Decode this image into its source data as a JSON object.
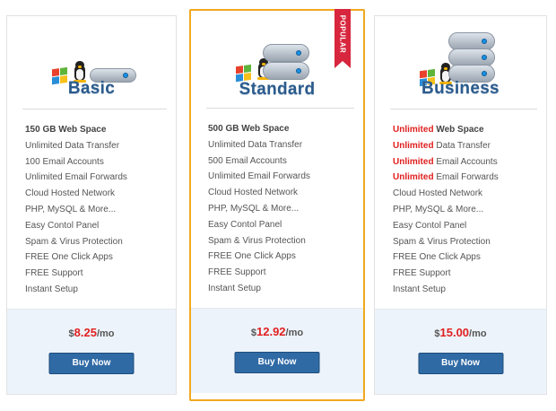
{
  "plans": [
    {
      "title": "Basic",
      "features": [
        {
          "hl": "",
          "text": "150 GB Web Space"
        },
        {
          "hl": "",
          "text": "Unlimited Data Transfer"
        },
        {
          "hl": "",
          "text": "100 Email Accounts"
        },
        {
          "hl": "",
          "text": "Unlimited Email Forwards"
        },
        {
          "hl": "",
          "text": "Cloud Hosted Network"
        },
        {
          "hl": "",
          "text": "PHP, MySQL & More..."
        },
        {
          "hl": "",
          "text": "Easy Contol Panel"
        },
        {
          "hl": "",
          "text": "Spam & Virus Protection"
        },
        {
          "hl": "",
          "text": "FREE One Click Apps"
        },
        {
          "hl": "",
          "text": "FREE Support"
        },
        {
          "hl": "",
          "text": "Instant Setup"
        }
      ],
      "price": {
        "currency": "$",
        "amount": "8.25",
        "period": "/mo"
      },
      "button": "Buy Now"
    },
    {
      "title": "Standard",
      "badge": "POPULAR",
      "features": [
        {
          "hl": "",
          "text": "500 GB Web Space"
        },
        {
          "hl": "",
          "text": "Unlimited Data Transfer"
        },
        {
          "hl": "",
          "text": "500 Email Accounts"
        },
        {
          "hl": "",
          "text": "Unlimited Email Forwards"
        },
        {
          "hl": "",
          "text": "Cloud Hosted Network"
        },
        {
          "hl": "",
          "text": "PHP, MySQL & More..."
        },
        {
          "hl": "",
          "text": "Easy Contol Panel"
        },
        {
          "hl": "",
          "text": "Spam & Virus Protection"
        },
        {
          "hl": "",
          "text": "FREE One Click Apps"
        },
        {
          "hl": "",
          "text": "FREE Support"
        },
        {
          "hl": "",
          "text": "Instant Setup"
        }
      ],
      "price": {
        "currency": "$",
        "amount": "12.92",
        "period": "/mo"
      },
      "button": "Buy Now"
    },
    {
      "title": "Business",
      "features": [
        {
          "hl": "Unlimited",
          "text": " Web Space"
        },
        {
          "hl": "Unlimited",
          "text": " Data Transfer"
        },
        {
          "hl": "Unlimited",
          "text": " Email Accounts"
        },
        {
          "hl": "Unlimited",
          "text": " Email Forwards"
        },
        {
          "hl": "",
          "text": "Cloud Hosted Network"
        },
        {
          "hl": "",
          "text": "PHP, MySQL & More..."
        },
        {
          "hl": "",
          "text": "Easy Contol Panel"
        },
        {
          "hl": "",
          "text": "Spam & Virus Protection"
        },
        {
          "hl": "",
          "text": "FREE One Click Apps"
        },
        {
          "hl": "",
          "text": "FREE Support"
        },
        {
          "hl": "",
          "text": "Instant Setup"
        }
      ],
      "price": {
        "currency": "$",
        "amount": "15.00",
        "period": "/mo"
      },
      "button": "Buy Now"
    }
  ],
  "colors": {
    "accent": "#2b5b8c",
    "highlight": "#e02020",
    "popular_border": "#f0a91f",
    "ribbon": "#d7263d",
    "button": "#2f6aa5"
  },
  "icons": [
    "windows-logo-icon",
    "linux-penguin-icon",
    "server-icon"
  ]
}
